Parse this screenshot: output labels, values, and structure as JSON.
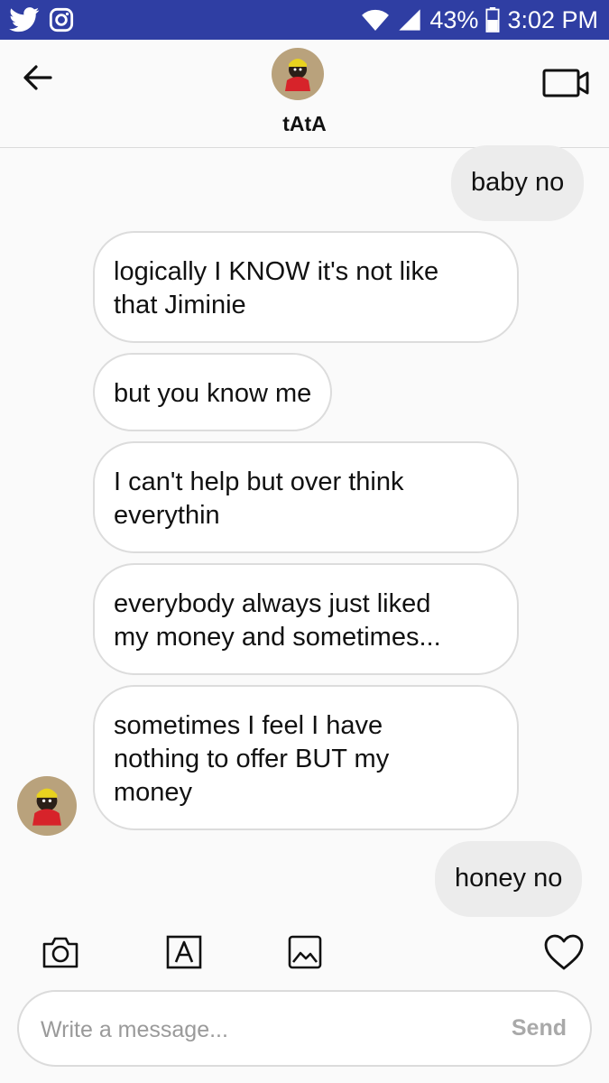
{
  "status_bar": {
    "battery": "43%",
    "time": "3:02 PM",
    "icons": [
      "twitter-icon",
      "instagram-icon",
      "wifi-icon",
      "signal-icon",
      "battery-icon"
    ]
  },
  "header": {
    "contact_name": "tAtA",
    "back_icon": "arrow-left-icon",
    "video_icon": "video-camera-icon"
  },
  "messages": [
    {
      "direction": "outgoing",
      "text": "baby no"
    },
    {
      "direction": "incoming",
      "text": "logically I KNOW it's not like\nthat Jiminie"
    },
    {
      "direction": "incoming",
      "text": "but you know me"
    },
    {
      "direction": "incoming",
      "text": "I can't help but over think\neverythin"
    },
    {
      "direction": "incoming",
      "text": "everybody always just liked\nmy money and sometimes..."
    },
    {
      "direction": "incoming",
      "text": "sometimes I feel I have\nnothing to offer BUT my\nmoney"
    },
    {
      "direction": "outgoing",
      "text": "honey no"
    }
  ],
  "toolbar": {
    "icons": [
      "camera-icon",
      "text-icon",
      "gallery-icon",
      "heart-icon"
    ]
  },
  "composer": {
    "placeholder": "Write a message...",
    "send_label": "Send"
  },
  "colors": {
    "status_bar": "#2f3ea3",
    "outgoing_bubble": "#ececec",
    "incoming_bubble": "#ffffff",
    "bubble_border": "#dcdcdc",
    "background": "#fafafa"
  }
}
